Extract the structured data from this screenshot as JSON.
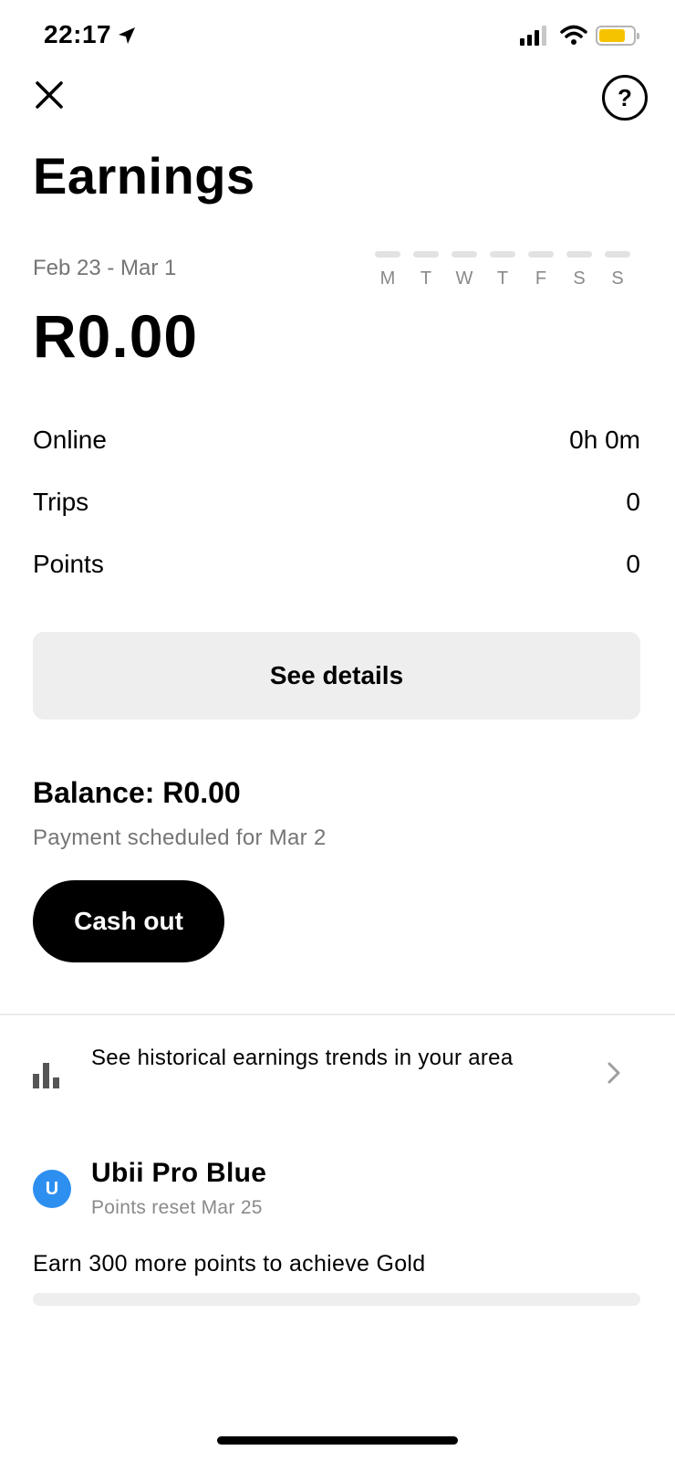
{
  "status_bar": {
    "time": "22:17",
    "location_icon": "location-arrow-icon",
    "signal_icon": "cellular-signal-icon",
    "wifi_icon": "wifi-icon",
    "battery_icon": "battery-icon",
    "battery_color": "#f5c300"
  },
  "header": {
    "close_icon": "close-icon",
    "help_label": "?",
    "title": "Earnings"
  },
  "summary": {
    "date_range": "Feb 23 - Mar 1",
    "amount": "R0.00",
    "week_days": [
      "M",
      "T",
      "W",
      "T",
      "F",
      "S",
      "S"
    ]
  },
  "stats": [
    {
      "label": "Online",
      "value": "0h 0m"
    },
    {
      "label": "Trips",
      "value": "0"
    },
    {
      "label": "Points",
      "value": "0"
    }
  ],
  "details_button": "See details",
  "balance": {
    "text": "Balance: R0.00",
    "note": "Payment scheduled for Mar 2",
    "cashout_label": "Cash out"
  },
  "trends": {
    "icon": "bar-chart-icon",
    "text": "See historical earnings trends in your area",
    "chevron_icon": "chevron-right-icon"
  },
  "tier": {
    "avatar_letter": "U",
    "avatar_color": "#2d8ff0",
    "name": "Ubii Pro Blue",
    "reset": "Points reset Mar 25",
    "goal": "Earn 300 more points to achieve Gold",
    "progress_fraction": 0
  }
}
